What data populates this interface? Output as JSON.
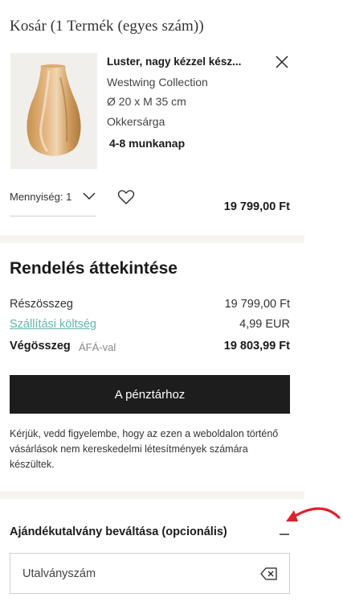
{
  "cart": {
    "title": "Kosár (1 Termék (egyes szám))"
  },
  "product": {
    "name": "Luster, nagy kézzel kész...",
    "brand": "Westwing Collection",
    "size": "Ø 20 x M 35 cm",
    "color": "Okkersárga",
    "delivery": "4-8 munkanap",
    "quantity_label": "Mennyiség: 1",
    "price": "19 799,00 Ft",
    "image_icon": "amber-glass-vase-image",
    "remove_icon": "close-icon",
    "wishlist_icon": "heart-icon",
    "quantity_icon": "chevron-down-icon"
  },
  "summary": {
    "title": "Rendelés áttekintése",
    "subtotal_label": "Részösszeg",
    "subtotal_value": "19 799,00 Ft",
    "shipping_label": "Szállítási költség",
    "shipping_value": "4,99 EUR",
    "total_label": "Végösszeg",
    "vat_label": "ÁFÁ-val",
    "total_value": "19 803,99 Ft",
    "checkout_label": "A pénztárhoz",
    "note": "Kérjük, vedd figyelembe, hogy az ezen a weboldalon történő vásárlások nem kereskedelmi létesítmények számára készültek."
  },
  "voucher": {
    "title": "Ajándékutalvány beváltása (opcionális)",
    "placeholder": "Utalványszám",
    "value": "",
    "collapse_icon": "minus-icon",
    "clear_icon": "backspace-clear-icon"
  },
  "colors": {
    "accent_link": "#5fb7ad",
    "button_bg": "#1d1d1d",
    "section_band": "#f6f4f1",
    "annotation_arrow": "#e0202a"
  }
}
